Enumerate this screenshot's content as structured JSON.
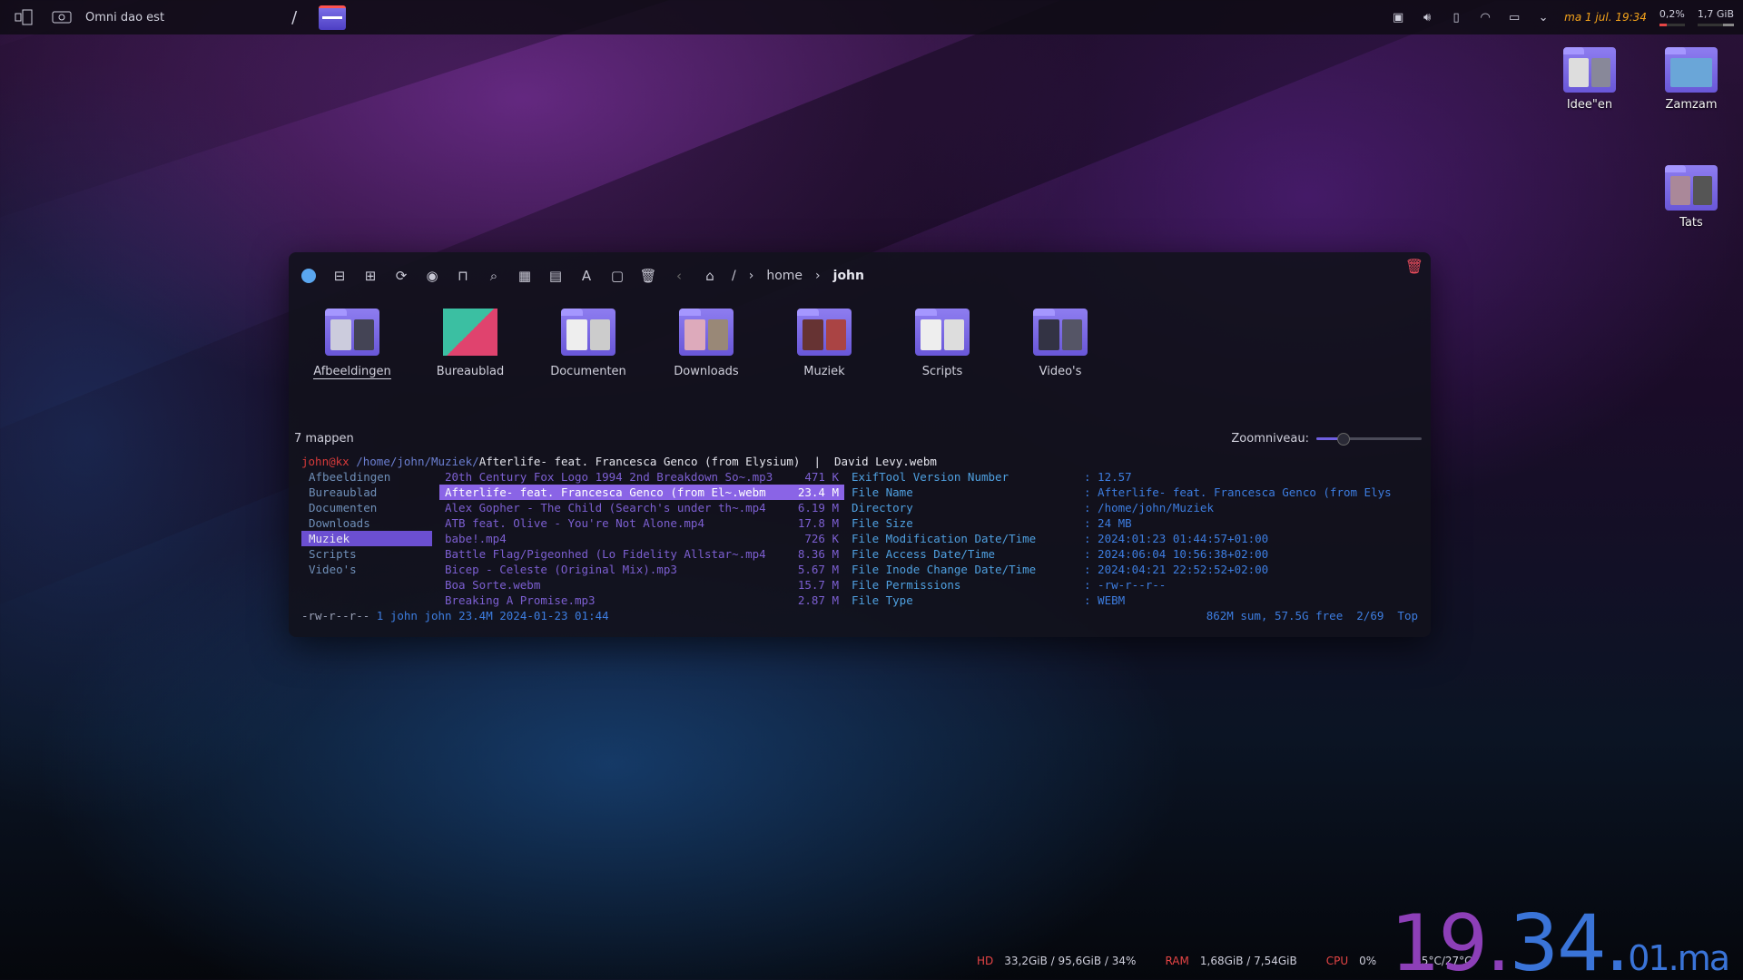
{
  "panel": {
    "title": "Omni dao est",
    "slash": "/",
    "clock": "ma 1 jul. 19:34",
    "cpu_load": "0,2%",
    "mem_used": "1,7 GiB"
  },
  "desktop": {
    "icons": [
      {
        "label": "Idee\"en"
      },
      {
        "label": "Zamzam"
      },
      {
        "label": "Tats"
      }
    ]
  },
  "window": {
    "breadcrumb": {
      "root": "/",
      "home": "home",
      "current": "john"
    },
    "places": [
      {
        "label": "Afbeeldingen"
      },
      {
        "label": "Bureaublad"
      },
      {
        "label": "Documenten"
      },
      {
        "label": "Downloads"
      },
      {
        "label": "Muziek"
      },
      {
        "label": "Scripts"
      },
      {
        "label": "Video's"
      }
    ],
    "folder_count": "7 mappen",
    "zoom_label": "Zoomniveau:",
    "zoom_level": 0.25
  },
  "terminal": {
    "user": "john@kx",
    "path": " /home/john/Muziek/",
    "file": "Afterlife- feat. Francesca Genco (from Elysium)  |  David Levy.webm",
    "col1": [
      "Afbeeldingen",
      "Bureaublad",
      "Documenten",
      "Downloads",
      "Muziek",
      "Scripts",
      "Video's"
    ],
    "col2": [
      {
        "name": "20th Century Fox Logo 1994 2nd Breakdown So~.mp3",
        "size": "471 K"
      },
      {
        "name": "Afterlife- feat. Francesca Genco (from El~.webm",
        "size": "23.4 M"
      },
      {
        "name": "Alex Gopher - The Child (Search's under th~.mp4",
        "size": "6.19 M"
      },
      {
        "name": "ATB feat. Olive - You're Not Alone.mp4",
        "size": "17.8 M"
      },
      {
        "name": "babe!.mp4",
        "size": "726 K"
      },
      {
        "name": "Battle Flag/Pigeonhed (Lo Fidelity Allstar~.mp4",
        "size": "8.36 M"
      },
      {
        "name": "Bicep - Celeste (Original Mix).mp3",
        "size": "5.67 M"
      },
      {
        "name": "Boa Sorte.webm",
        "size": "15.7 M"
      },
      {
        "name": "Breaking A Promise.mp3",
        "size": "2.87 M"
      }
    ],
    "col3": [
      {
        "k": "ExifTool Version Number",
        "v": ": 12.57"
      },
      {
        "k": "File Name",
        "v": ": Afterlife- feat. Francesca Genco (from Elys"
      },
      {
        "k": "Directory",
        "v": ": /home/john/Muziek"
      },
      {
        "k": "File Size",
        "v": ": 24 MB"
      },
      {
        "k": "File Modification Date/Time",
        "v": ": 2024:01:23 01:44:57+01:00"
      },
      {
        "k": "File Access Date/Time",
        "v": ": 2024:06:04 10:56:38+02:00"
      },
      {
        "k": "File Inode Change Date/Time",
        "v": ": 2024:04:21 22:52:52+02:00"
      },
      {
        "k": "File Permissions",
        "v": ": -rw-r--r--"
      },
      {
        "k": "File Type",
        "v": ": WEBM"
      }
    ],
    "footer_perm": "-rw-r--r--",
    "footer_meta": " 1 john john 23.4M 2024-01-23 01:44",
    "footer_right": "862M sum, 57.5G free  2/69  Top"
  },
  "sysbar": {
    "hd_label": "HD",
    "hd_val": "33,2GiB / 95,6GiB / 34%",
    "ram_label": "RAM",
    "ram_val": "1,68GiB / 7,54GiB",
    "cpu_label": "CPU",
    "cpu_val": "0%",
    "temp": "35°C/27°C"
  },
  "bigclock": {
    "main": "19.",
    "mid": "34.",
    "sec": "01.",
    "suffix": "ma"
  },
  "colors": {
    "accent": "#6b4fd1",
    "clock": "#f3a21a",
    "alert": "#e64545"
  }
}
